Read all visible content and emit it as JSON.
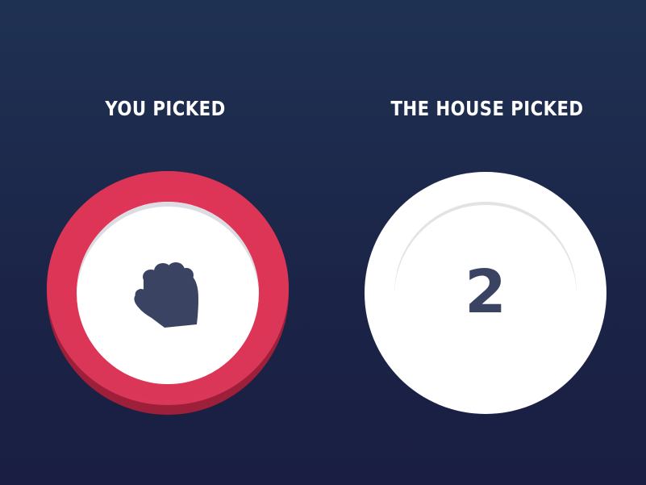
{
  "player": {
    "label": "YOU PICKED",
    "choice_icon": "rock-fist-icon",
    "ring_color": "#dc3556"
  },
  "house": {
    "label": "THE HOUSE PICKED",
    "countdown": "2"
  },
  "colors": {
    "background_top": "#1f3153",
    "background_bottom": "#191e42",
    "icon_color": "#3b4363"
  }
}
